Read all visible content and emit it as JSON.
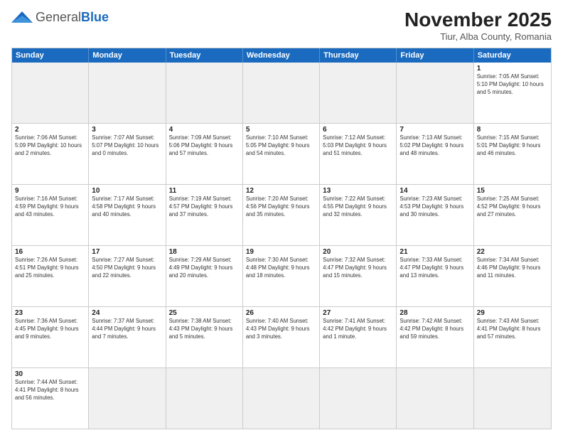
{
  "header": {
    "logo_general": "General",
    "logo_blue": "Blue",
    "month_title": "November 2025",
    "subtitle": "Tiur, Alba County, Romania"
  },
  "days_of_week": [
    "Sunday",
    "Monday",
    "Tuesday",
    "Wednesday",
    "Thursday",
    "Friday",
    "Saturday"
  ],
  "weeks": [
    [
      {
        "day": "",
        "info": "",
        "shaded": true
      },
      {
        "day": "",
        "info": "",
        "shaded": true
      },
      {
        "day": "",
        "info": "",
        "shaded": true
      },
      {
        "day": "",
        "info": "",
        "shaded": true
      },
      {
        "day": "",
        "info": "",
        "shaded": true
      },
      {
        "day": "",
        "info": "",
        "shaded": true
      },
      {
        "day": "1",
        "info": "Sunrise: 7:05 AM\nSunset: 5:10 PM\nDaylight: 10 hours and 5 minutes.",
        "shaded": false
      }
    ],
    [
      {
        "day": "2",
        "info": "Sunrise: 7:06 AM\nSunset: 5:09 PM\nDaylight: 10 hours and 2 minutes.",
        "shaded": false
      },
      {
        "day": "3",
        "info": "Sunrise: 7:07 AM\nSunset: 5:07 PM\nDaylight: 10 hours and 0 minutes.",
        "shaded": false
      },
      {
        "day": "4",
        "info": "Sunrise: 7:09 AM\nSunset: 5:06 PM\nDaylight: 9 hours and 57 minutes.",
        "shaded": false
      },
      {
        "day": "5",
        "info": "Sunrise: 7:10 AM\nSunset: 5:05 PM\nDaylight: 9 hours and 54 minutes.",
        "shaded": false
      },
      {
        "day": "6",
        "info": "Sunrise: 7:12 AM\nSunset: 5:03 PM\nDaylight: 9 hours and 51 minutes.",
        "shaded": false
      },
      {
        "day": "7",
        "info": "Sunrise: 7:13 AM\nSunset: 5:02 PM\nDaylight: 9 hours and 48 minutes.",
        "shaded": false
      },
      {
        "day": "8",
        "info": "Sunrise: 7:15 AM\nSunset: 5:01 PM\nDaylight: 9 hours and 46 minutes.",
        "shaded": false
      }
    ],
    [
      {
        "day": "9",
        "info": "Sunrise: 7:16 AM\nSunset: 4:59 PM\nDaylight: 9 hours and 43 minutes.",
        "shaded": false
      },
      {
        "day": "10",
        "info": "Sunrise: 7:17 AM\nSunset: 4:58 PM\nDaylight: 9 hours and 40 minutes.",
        "shaded": false
      },
      {
        "day": "11",
        "info": "Sunrise: 7:19 AM\nSunset: 4:57 PM\nDaylight: 9 hours and 37 minutes.",
        "shaded": false
      },
      {
        "day": "12",
        "info": "Sunrise: 7:20 AM\nSunset: 4:56 PM\nDaylight: 9 hours and 35 minutes.",
        "shaded": false
      },
      {
        "day": "13",
        "info": "Sunrise: 7:22 AM\nSunset: 4:55 PM\nDaylight: 9 hours and 32 minutes.",
        "shaded": false
      },
      {
        "day": "14",
        "info": "Sunrise: 7:23 AM\nSunset: 4:53 PM\nDaylight: 9 hours and 30 minutes.",
        "shaded": false
      },
      {
        "day": "15",
        "info": "Sunrise: 7:25 AM\nSunset: 4:52 PM\nDaylight: 9 hours and 27 minutes.",
        "shaded": false
      }
    ],
    [
      {
        "day": "16",
        "info": "Sunrise: 7:26 AM\nSunset: 4:51 PM\nDaylight: 9 hours and 25 minutes.",
        "shaded": false
      },
      {
        "day": "17",
        "info": "Sunrise: 7:27 AM\nSunset: 4:50 PM\nDaylight: 9 hours and 22 minutes.",
        "shaded": false
      },
      {
        "day": "18",
        "info": "Sunrise: 7:29 AM\nSunset: 4:49 PM\nDaylight: 9 hours and 20 minutes.",
        "shaded": false
      },
      {
        "day": "19",
        "info": "Sunrise: 7:30 AM\nSunset: 4:48 PM\nDaylight: 9 hours and 18 minutes.",
        "shaded": false
      },
      {
        "day": "20",
        "info": "Sunrise: 7:32 AM\nSunset: 4:47 PM\nDaylight: 9 hours and 15 minutes.",
        "shaded": false
      },
      {
        "day": "21",
        "info": "Sunrise: 7:33 AM\nSunset: 4:47 PM\nDaylight: 9 hours and 13 minutes.",
        "shaded": false
      },
      {
        "day": "22",
        "info": "Sunrise: 7:34 AM\nSunset: 4:46 PM\nDaylight: 9 hours and 11 minutes.",
        "shaded": false
      }
    ],
    [
      {
        "day": "23",
        "info": "Sunrise: 7:36 AM\nSunset: 4:45 PM\nDaylight: 9 hours and 9 minutes.",
        "shaded": false
      },
      {
        "day": "24",
        "info": "Sunrise: 7:37 AM\nSunset: 4:44 PM\nDaylight: 9 hours and 7 minutes.",
        "shaded": false
      },
      {
        "day": "25",
        "info": "Sunrise: 7:38 AM\nSunset: 4:43 PM\nDaylight: 9 hours and 5 minutes.",
        "shaded": false
      },
      {
        "day": "26",
        "info": "Sunrise: 7:40 AM\nSunset: 4:43 PM\nDaylight: 9 hours and 3 minutes.",
        "shaded": false
      },
      {
        "day": "27",
        "info": "Sunrise: 7:41 AM\nSunset: 4:42 PM\nDaylight: 9 hours and 1 minute.",
        "shaded": false
      },
      {
        "day": "28",
        "info": "Sunrise: 7:42 AM\nSunset: 4:42 PM\nDaylight: 8 hours and 59 minutes.",
        "shaded": false
      },
      {
        "day": "29",
        "info": "Sunrise: 7:43 AM\nSunset: 4:41 PM\nDaylight: 8 hours and 57 minutes.",
        "shaded": false
      }
    ],
    [
      {
        "day": "30",
        "info": "Sunrise: 7:44 AM\nSunset: 4:41 PM\nDaylight: 8 hours and 56 minutes.",
        "shaded": false
      },
      {
        "day": "",
        "info": "",
        "shaded": true
      },
      {
        "day": "",
        "info": "",
        "shaded": true
      },
      {
        "day": "",
        "info": "",
        "shaded": true
      },
      {
        "day": "",
        "info": "",
        "shaded": true
      },
      {
        "day": "",
        "info": "",
        "shaded": true
      },
      {
        "day": "",
        "info": "",
        "shaded": true
      }
    ]
  ]
}
